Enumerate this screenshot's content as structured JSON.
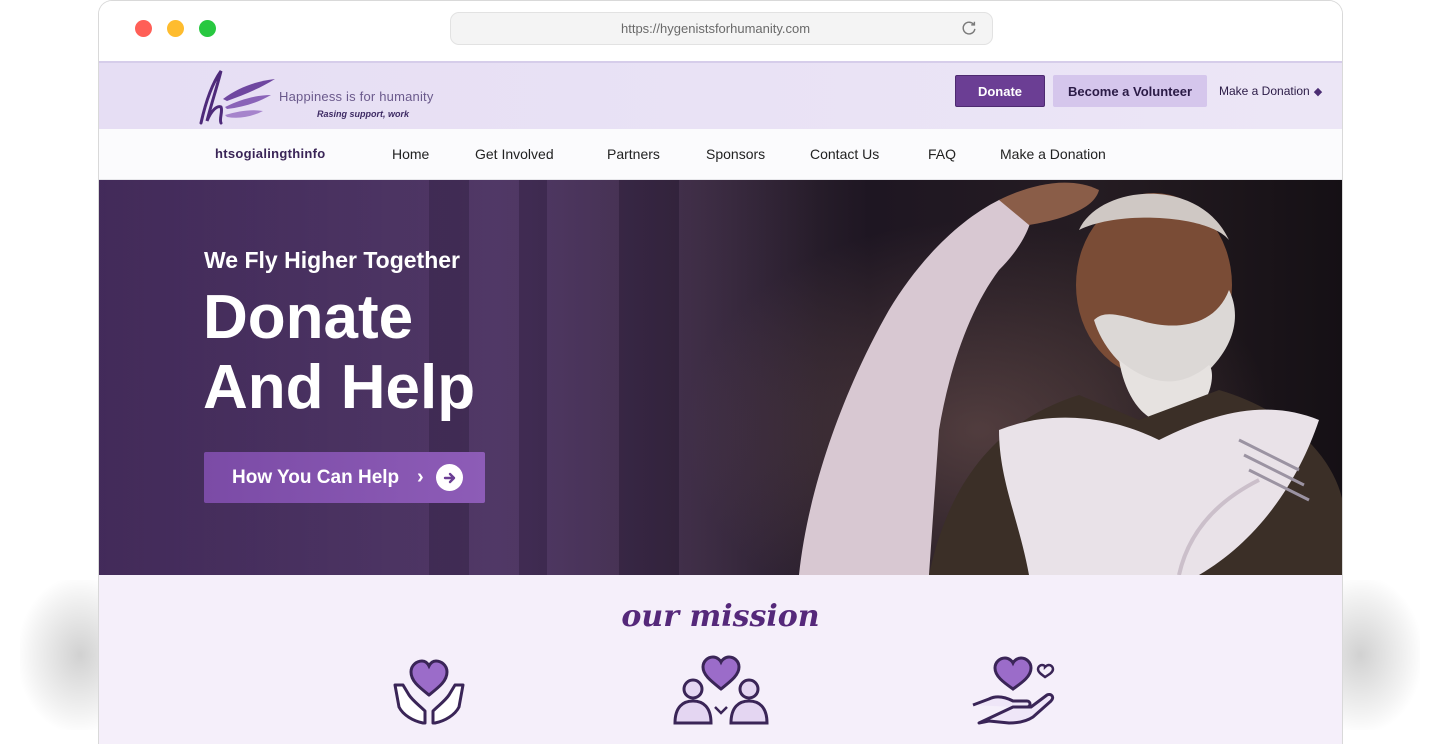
{
  "browser": {
    "url": "https://hygenistsforhumanity.com"
  },
  "topbar": {
    "tagline": "Happiness is for humanity",
    "subtag": "Rasing support, work",
    "donate_label": "Donate",
    "volunteer_label": "Become a Volunteer",
    "make_donation_label": "Make a Donation"
  },
  "nav": {
    "brand": "htsogialingthinfo",
    "items": [
      "Home",
      "Get Involved",
      "Partners",
      "Sponsors",
      "Contact Us",
      "FAQ",
      "Make a Donation"
    ]
  },
  "hero": {
    "subtitle": "We Fly Higher Together",
    "title_line1": "Donate",
    "title_line2": "And Help",
    "cta_label": "How You Can Help"
  },
  "mission": {
    "title": "our mission",
    "icons": [
      "hands-heart-icon",
      "community-heart-icon",
      "hand-giving-heart-icon"
    ]
  },
  "colors": {
    "brand_purple": "#6b3e94",
    "light_purple": "#d5c6ec",
    "mission_bg": "#f5effa",
    "topbar_bg": "#e6def4"
  }
}
